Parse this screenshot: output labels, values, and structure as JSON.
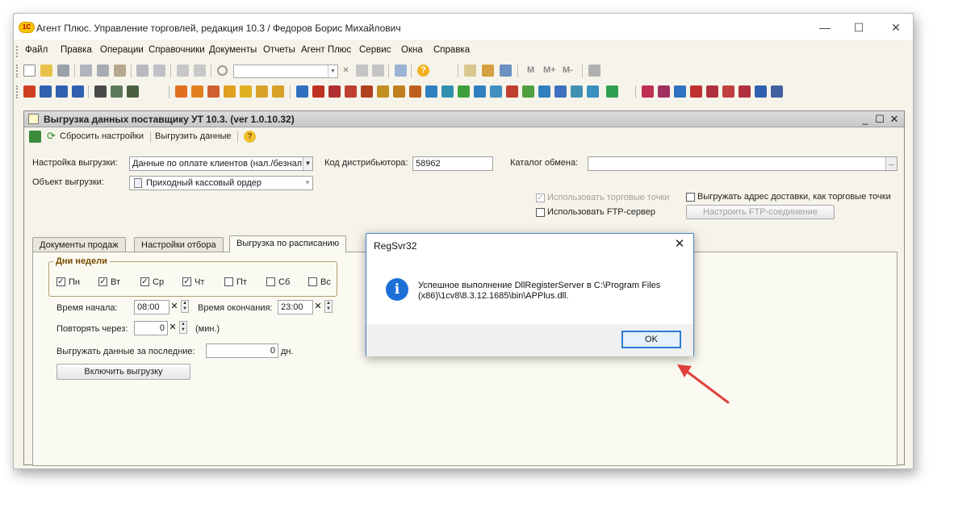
{
  "app": {
    "logo_text": "1С",
    "title": "Агент Плюс. Управление торговлей, редакция 10.3 / Федоров Борис Михайлович"
  },
  "window_controls": {
    "minimize": "—",
    "maximize": "☐",
    "close": "✕"
  },
  "menu": [
    "Файл",
    "Правка",
    "Операции",
    "Справочники",
    "Документы",
    "Отчеты",
    "Агент Плюс",
    "Сервис",
    "Окна",
    "Справка"
  ],
  "toolbar": {
    "text_buttons": [
      "M",
      "M+",
      "M-"
    ],
    "question_icon": "?"
  },
  "child_window": {
    "title": "Выгрузка данных поставщику УТ 10.3. (ver 1.0.10.32)",
    "controls": {
      "minimize": "_",
      "maximize": "☐",
      "close": "✕"
    },
    "toolbar": {
      "reset": "Сбросить настройки",
      "export": "Выгрузить данные",
      "help": "?"
    }
  },
  "form": {
    "settings_label": "Настройка выгрузки:",
    "settings_value": "Данные по оплате клиентов (нал./безнал",
    "distributor_label": "Код дистрибьютора:",
    "distributor_value": "58962",
    "catalog_label": "Каталог обмена:",
    "catalog_value": "",
    "catalog_btn": "...",
    "object_label": "Объект выгрузки:",
    "object_value": "Приходный кассовый ордер",
    "use_trade_points": "Использовать торговые точки",
    "use_ftp": "Использовать FTP-сервер",
    "export_address": "Выгружать адрес доставки, как торговые точки",
    "ftp_setup_btn": "Настроить FTP-соединение"
  },
  "tabs": [
    "Документы продаж",
    "Настройки отбора",
    "Выгрузка по расписанию"
  ],
  "schedule": {
    "days_title": "Дни недели",
    "days": [
      {
        "label": "Пн",
        "checked": true
      },
      {
        "label": "Вт",
        "checked": true
      },
      {
        "label": "Ср",
        "checked": true
      },
      {
        "label": "Чт",
        "checked": true
      },
      {
        "label": "Пт",
        "checked": false
      },
      {
        "label": "Сб",
        "checked": false
      },
      {
        "label": "Вс",
        "checked": false
      }
    ],
    "start_label": "Время начала:",
    "start_value": "08:00",
    "end_label": "Время окончания:",
    "end_value": "23:00",
    "repeat_label": "Повторять через:",
    "repeat_value": "0",
    "repeat_unit": "(мин.)",
    "last_label": "Выгружать данные за последние:",
    "last_value": "0",
    "last_unit": "дн.",
    "enable_btn": "Включить выгрузку",
    "clear_symbol": "✕",
    "spin_up": "▲",
    "spin_down": "▼"
  },
  "dialog": {
    "title": "RegSvr32",
    "close": "✕",
    "icon": "i",
    "message": "Успешное выполнение DllRegisterServer в C:\\Program Files (x86)\\1cv8\\8.3.12.1685\\bin\\APPlus.dll.",
    "ok": "OK"
  },
  "colors": {
    "annotation_arrow": "#e0403a",
    "dialog_border": "#4a86c8",
    "info_icon": "#1c6fd6",
    "groupbox_title": "#7a4b00"
  }
}
